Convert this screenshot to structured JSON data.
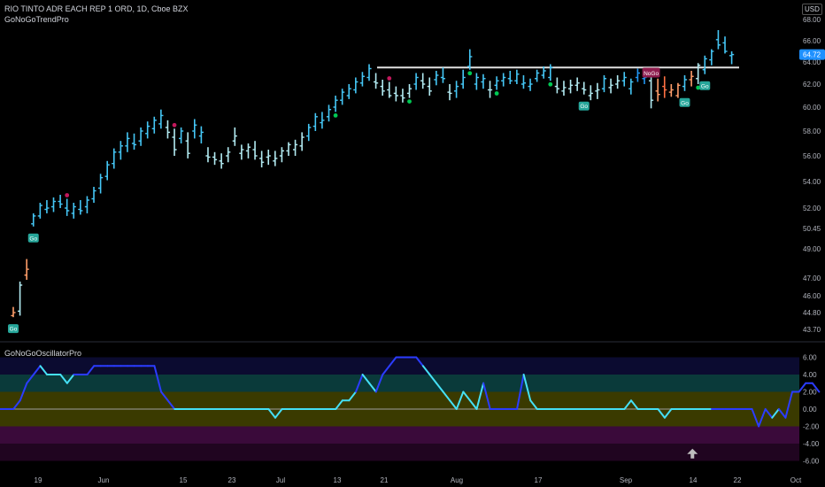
{
  "header": {
    "symbol_line": "RIO TINTO ADR EACH REP 1 ORD, 1D, Cboe BZX",
    "indicator_price": "GoNoGoTrendPro",
    "indicator_osc": "GoNoGoOscillatorPro",
    "currency": "USD"
  },
  "chart_data": [
    {
      "type": "ohlc",
      "panel": "price",
      "x_tick_labels": [
        "19",
        "Jun",
        "15",
        "23",
        "Jul",
        "13",
        "21",
        "Aug",
        "17",
        "Sep",
        "14",
        "22",
        "Oct"
      ],
      "y_tick_labels": [
        "43.70",
        "44.80",
        "46.00",
        "47.00",
        "49.00",
        "50.45",
        "52.00",
        "54.00",
        "56.00",
        "58.00",
        "60.00",
        "62.00",
        "64.00",
        "66.00",
        "68.00"
      ],
      "ylim": [
        43.0,
        69.2
      ],
      "current_price_label": "64.72",
      "resistance_level": 63.5,
      "colors": {
        "strong_go": "#2196f3",
        "go": "#45c7f6",
        "weak_go": "#b2ebf2",
        "nogo": "#ff9e6a",
        "strong_nogo": "#ff7043",
        "resistance": "#e0e0e0",
        "price_tag": "#1e90ff"
      },
      "bars": [
        [
          44.6,
          45.2,
          44.5,
          44.8,
          "nogo"
        ],
        [
          44.9,
          46.8,
          44.6,
          46.6,
          "weak_go"
        ],
        [
          47.2,
          48.3,
          46.9,
          47.6,
          "nogo"
        ],
        [
          50.8,
          51.6,
          50.6,
          51.4,
          "go"
        ],
        [
          51.4,
          52.4,
          51.2,
          52.2,
          "go"
        ],
        [
          51.9,
          52.6,
          51.6,
          52.0,
          "go"
        ],
        [
          52.1,
          52.8,
          51.7,
          52.5,
          "go"
        ],
        [
          52.5,
          53.0,
          52.0,
          52.3,
          "go"
        ],
        [
          52.0,
          52.7,
          51.4,
          51.8,
          "go"
        ],
        [
          51.6,
          52.4,
          51.2,
          52.1,
          "go"
        ],
        [
          51.9,
          52.6,
          51.5,
          51.8,
          "go"
        ],
        [
          52.1,
          52.9,
          51.6,
          52.6,
          "go"
        ],
        [
          52.7,
          53.6,
          52.4,
          53.3,
          "go"
        ],
        [
          53.5,
          54.6,
          53.1,
          54.3,
          "go"
        ],
        [
          54.4,
          55.6,
          54.1,
          55.3,
          "go"
        ],
        [
          55.4,
          56.6,
          55.0,
          56.3,
          "go"
        ],
        [
          56.3,
          57.2,
          55.7,
          56.8,
          "go"
        ],
        [
          56.8,
          57.9,
          56.3,
          57.4,
          "go"
        ],
        [
          57.0,
          57.8,
          56.5,
          56.9,
          "go"
        ],
        [
          57.2,
          58.3,
          56.8,
          58.0,
          "go"
        ],
        [
          57.8,
          58.8,
          57.4,
          58.4,
          "go"
        ],
        [
          58.2,
          59.2,
          57.8,
          58.9,
          "go"
        ],
        [
          58.6,
          59.8,
          58.2,
          59.3,
          "go"
        ],
        [
          58.3,
          58.9,
          57.4,
          57.9,
          "weak_go"
        ],
        [
          57.5,
          58.2,
          56.0,
          56.5,
          "weak_go"
        ],
        [
          57.4,
          58.3,
          57.0,
          58.0,
          "go"
        ],
        [
          57.2,
          57.9,
          55.8,
          56.2,
          "weak_go"
        ],
        [
          58.0,
          59.0,
          57.4,
          58.5,
          "go"
        ],
        [
          57.6,
          58.4,
          57.0,
          57.9,
          "go"
        ],
        [
          56.0,
          56.7,
          55.5,
          55.9,
          "weak_go"
        ],
        [
          55.9,
          56.3,
          55.3,
          55.7,
          "weak_go"
        ],
        [
          55.6,
          56.2,
          55.0,
          55.4,
          "weak_go"
        ],
        [
          56.0,
          56.7,
          55.5,
          56.3,
          "weak_go"
        ],
        [
          57.2,
          58.3,
          56.8,
          57.6,
          "weak_go"
        ],
        [
          56.2,
          56.9,
          55.7,
          56.5,
          "weak_go"
        ],
        [
          56.4,
          57.0,
          55.8,
          56.7,
          "weak_go"
        ],
        [
          56.5,
          57.2,
          55.7,
          56.0,
          "weak_go"
        ],
        [
          55.8,
          56.4,
          55.1,
          55.5,
          "weak_go"
        ],
        [
          55.9,
          56.5,
          55.3,
          56.0,
          "weak_go"
        ],
        [
          55.6,
          56.4,
          55.2,
          55.8,
          "weak_go"
        ],
        [
          56.0,
          56.7,
          55.5,
          56.4,
          "weak_go"
        ],
        [
          56.4,
          57.1,
          56.0,
          56.9,
          "weak_go"
        ],
        [
          56.5,
          57.3,
          56.0,
          56.9,
          "weak_go"
        ],
        [
          56.8,
          57.9,
          56.4,
          57.5,
          "weak_go"
        ],
        [
          57.6,
          58.6,
          57.2,
          58.3,
          "go"
        ],
        [
          58.4,
          59.5,
          58.0,
          59.2,
          "go"
        ],
        [
          58.7,
          59.6,
          58.2,
          58.9,
          "go"
        ],
        [
          59.2,
          60.2,
          58.8,
          59.8,
          "go"
        ],
        [
          60.0,
          61.0,
          59.6,
          60.6,
          "go"
        ],
        [
          60.6,
          61.6,
          60.2,
          61.3,
          "go"
        ],
        [
          61.0,
          62.0,
          60.7,
          61.6,
          "go"
        ],
        [
          61.5,
          62.6,
          61.2,
          62.2,
          "go"
        ],
        [
          62.1,
          63.1,
          61.8,
          62.7,
          "go"
        ],
        [
          62.6,
          63.8,
          62.3,
          63.4,
          "go"
        ],
        [
          62.2,
          63.0,
          61.6,
          62.1,
          "weak_go"
        ],
        [
          61.8,
          62.4,
          61.0,
          61.4,
          "weak_go"
        ],
        [
          61.5,
          62.2,
          60.8,
          61.0,
          "weak_go"
        ],
        [
          61.2,
          61.8,
          60.5,
          61.0,
          "weak_go"
        ],
        [
          61.0,
          61.6,
          60.4,
          60.8,
          "weak_go"
        ],
        [
          61.2,
          62.0,
          60.8,
          61.6,
          "weak_go"
        ],
        [
          62.0,
          63.0,
          61.5,
          62.6,
          "go"
        ],
        [
          62.3,
          63.0,
          61.6,
          62.0,
          "weak_go"
        ],
        [
          61.8,
          62.6,
          61.0,
          61.4,
          "weak_go"
        ],
        [
          62.4,
          63.2,
          61.9,
          62.8,
          "go"
        ],
        [
          62.6,
          63.5,
          62.1,
          62.5,
          "go"
        ],
        [
          61.3,
          62.0,
          60.6,
          61.2,
          "weak_go"
        ],
        [
          61.4,
          62.3,
          60.8,
          61.8,
          "go"
        ],
        [
          62.0,
          63.3,
          61.6,
          62.6,
          "go"
        ],
        [
          63.6,
          65.2,
          63.3,
          64.5,
          "go"
        ],
        [
          62.0,
          63.0,
          61.5,
          62.6,
          "go"
        ],
        [
          62.2,
          62.9,
          61.6,
          62.5,
          "go"
        ],
        [
          61.5,
          62.3,
          60.8,
          61.5,
          "weak_go"
        ],
        [
          61.9,
          62.7,
          61.5,
          62.3,
          "go"
        ],
        [
          62.3,
          63.0,
          61.8,
          62.6,
          "go"
        ],
        [
          62.5,
          63.2,
          62.0,
          62.3,
          "go"
        ],
        [
          62.3,
          63.3,
          62.0,
          62.9,
          "go"
        ],
        [
          62.0,
          62.8,
          61.6,
          62.1,
          "go"
        ],
        [
          61.8,
          62.5,
          61.4,
          62.0,
          "go"
        ],
        [
          62.5,
          63.3,
          62.2,
          63.0,
          "go"
        ],
        [
          62.8,
          63.6,
          62.5,
          63.2,
          "go"
        ],
        [
          62.6,
          63.8,
          62.3,
          63.5,
          "go"
        ],
        [
          61.8,
          62.6,
          61.2,
          61.6,
          "weak_go"
        ],
        [
          61.4,
          62.3,
          61.0,
          61.7,
          "weak_go"
        ],
        [
          61.6,
          62.4,
          61.2,
          61.9,
          "weak_go"
        ],
        [
          61.9,
          62.6,
          61.4,
          62.1,
          "weak_go"
        ],
        [
          61.6,
          62.2,
          61.1,
          61.5,
          "weak_go"
        ],
        [
          61.0,
          61.9,
          60.6,
          61.2,
          "weak_go"
        ],
        [
          61.4,
          62.1,
          60.7,
          61.5,
          "weak_go"
        ],
        [
          61.6,
          62.8,
          61.3,
          62.5,
          "go"
        ],
        [
          61.7,
          62.5,
          61.2,
          61.9,
          "weak_go"
        ],
        [
          62.0,
          62.8,
          61.6,
          62.3,
          "weak_go"
        ],
        [
          62.3,
          63.1,
          61.8,
          62.6,
          "go"
        ],
        [
          61.6,
          62.5,
          61.1,
          62.2,
          "go"
        ],
        [
          62.6,
          63.4,
          62.2,
          63.0,
          "strong_go"
        ],
        [
          62.5,
          63.1,
          62.0,
          62.6,
          "strong_go"
        ],
        [
          62.3,
          63.0,
          59.9,
          60.6,
          "weak_go"
        ],
        [
          61.4,
          62.5,
          60.5,
          61.1,
          "nogo"
        ],
        [
          61.8,
          62.7,
          60.8,
          61.5,
          "strong_nogo"
        ],
        [
          61.3,
          62.0,
          60.9,
          61.5,
          "nogo"
        ],
        [
          61.0,
          62.1,
          60.8,
          61.9,
          "nogo"
        ],
        [
          61.8,
          62.8,
          61.4,
          62.4,
          "go"
        ],
        [
          62.4,
          63.2,
          61.8,
          62.7,
          "nogo"
        ],
        [
          62.5,
          63.9,
          62.0,
          63.7,
          "weak_go"
        ],
        [
          63.3,
          64.6,
          62.9,
          64.3,
          "go"
        ],
        [
          64.2,
          65.2,
          63.7,
          65.0,
          "go"
        ],
        [
          66.1,
          67.0,
          65.2,
          65.6,
          "go"
        ],
        [
          65.8,
          66.4,
          64.8,
          65.0,
          "go"
        ],
        [
          64.6,
          65.0,
          63.8,
          64.7,
          "go"
        ]
      ],
      "go_labels": [
        {
          "bar": 0,
          "text": "Go"
        },
        {
          "bar": 3,
          "text": "Go"
        },
        {
          "bar": 85,
          "text": "Go"
        },
        {
          "bar": 100,
          "text": "Go"
        },
        {
          "bar": 103,
          "text": "Go"
        }
      ],
      "nogo_label": {
        "bar": 95,
        "text": "NoGo"
      },
      "dots": [
        {
          "bar": 8,
          "color": "#c2185b",
          "pos": "above"
        },
        {
          "bar": 24,
          "color": "#c2185b",
          "pos": "above"
        },
        {
          "bar": 48,
          "color": "#00c853",
          "pos": "below"
        },
        {
          "bar": 56,
          "color": "#c2185b",
          "pos": "above"
        },
        {
          "bar": 59,
          "color": "#00c853",
          "pos": "below"
        },
        {
          "bar": 68,
          "color": "#00c853",
          "pos": "below"
        },
        {
          "bar": 72,
          "color": "#00c853",
          "pos": "below"
        },
        {
          "bar": 80,
          "color": "#00c853",
          "pos": "below"
        },
        {
          "bar": 102,
          "color": "#00c853",
          "pos": "below"
        }
      ]
    },
    {
      "type": "line",
      "panel": "oscillator",
      "y_tick_labels": [
        "6.00",
        "4.00",
        "2.00",
        "0.00",
        "-2.00",
        "-4.00",
        "-6.00"
      ],
      "ylim": [
        -7.5,
        7.5
      ],
      "zero_line": 0,
      "colors": {
        "strong": "#2b3cff",
        "normal": "#45e0f5",
        "band_top": "#0b0b30",
        "band_upper": "#0a3a3a",
        "band_mid": "#3a3a00",
        "band_lower": "#3a0a3a",
        "band_bottom": "#200520",
        "marker": "#bdbdbd"
      },
      "values": [
        0,
        0,
        0,
        1,
        3,
        4,
        5,
        4,
        4,
        4,
        3,
        4,
        4,
        4,
        5,
        5,
        5,
        5,
        5,
        5,
        5,
        5,
        5,
        5,
        2,
        1,
        0,
        0,
        0,
        0,
        0,
        0,
        0,
        0,
        0,
        0,
        0,
        0,
        0,
        0,
        0,
        -1,
        0,
        0,
        0,
        0,
        0,
        0,
        0,
        0,
        0,
        1,
        1,
        2,
        4,
        3,
        2,
        4,
        5,
        6,
        6,
        6,
        6,
        5,
        4,
        3,
        2,
        1,
        0,
        2,
        1,
        0,
        3,
        0,
        0,
        0,
        0,
        0,
        4,
        1,
        0,
        0,
        0,
        0,
        0,
        0,
        0,
        0,
        0,
        0,
        0,
        0,
        0,
        0,
        1,
        0,
        0,
        0,
        0,
        -1,
        0,
        0,
        0,
        0,
        0,
        0,
        0,
        0,
        0,
        0,
        0,
        0,
        0,
        -2,
        0,
        -1,
        0,
        -1,
        2,
        2,
        3,
        3,
        2
      ],
      "strength": [
        "s",
        "s",
        "s",
        "s",
        "s",
        "s",
        "s",
        "n",
        "n",
        "n",
        "n",
        "n",
        "s",
        "s",
        "s",
        "s",
        "s",
        "s",
        "s",
        "s",
        "s",
        "s",
        "s",
        "s",
        "s",
        "s",
        "s",
        "n",
        "n",
        "n",
        "n",
        "n",
        "n",
        "n",
        "n",
        "n",
        "n",
        "n",
        "n",
        "n",
        "n",
        "n",
        "n",
        "n",
        "n",
        "n",
        "n",
        "n",
        "n",
        "n",
        "n",
        "n",
        "n",
        "n",
        "s",
        "n",
        "n",
        "s",
        "s",
        "s",
        "s",
        "s",
        "s",
        "s",
        "n",
        "n",
        "n",
        "n",
        "n",
        "n",
        "n",
        "n",
        "n",
        "s",
        "s",
        "s",
        "s",
        "s",
        "s",
        "n",
        "n",
        "n",
        "n",
        "n",
        "n",
        "n",
        "n",
        "n",
        "n",
        "n",
        "n",
        "n",
        "n",
        "n",
        "n",
        "n",
        "n",
        "n",
        "n",
        "n",
        "n",
        "n",
        "n",
        "n",
        "n",
        "n",
        "n",
        "s",
        "s",
        "s",
        "s",
        "s",
        "s",
        "s",
        "s",
        "s",
        "n",
        "s",
        "s",
        "s",
        "s",
        "s",
        "s"
      ],
      "marker": {
        "type": "up-arrow",
        "bar": 103,
        "y": -5
      }
    }
  ]
}
